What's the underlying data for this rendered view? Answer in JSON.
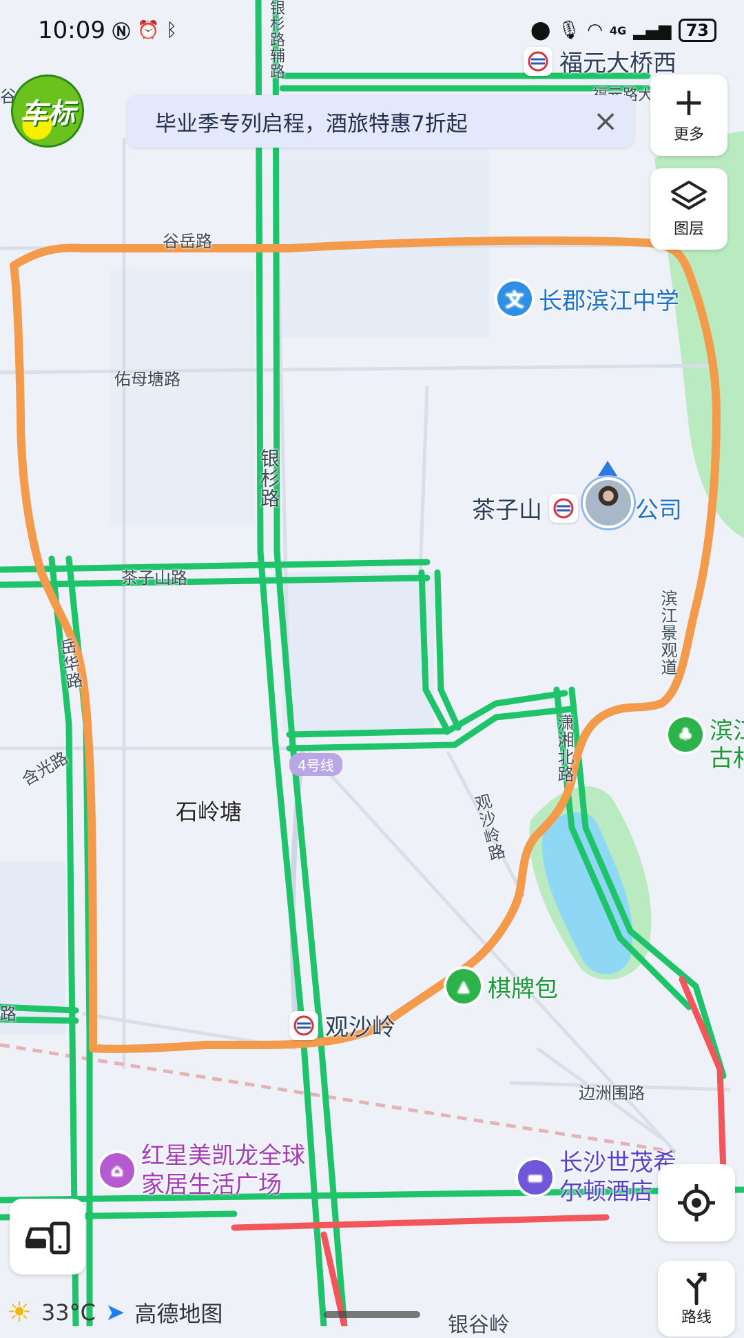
{
  "status_bar": {
    "time": "10:09",
    "battery": "73",
    "network": "4G"
  },
  "banner": {
    "text": "毕业季专列启程，酒旅特惠7折起"
  },
  "logo": {
    "text": "车标"
  },
  "controls": {
    "more_label": "更多",
    "layers_label": "图层",
    "route_label": "路线"
  },
  "road_labels": {
    "guyue": "谷岳路",
    "youmutang": "佑母塘路",
    "yinshan": "银杉路",
    "chazishan": "茶子山路",
    "yuehua": "岳华路",
    "hanguang": "含光路",
    "guanshaling_road": "观沙岭路",
    "xiaoxiang_north": "潇湘北路",
    "binjiang_jingguan": "滨江景观道",
    "bianzhouwei": "边洲围路",
    "fuyuan_road": "福元路大",
    "road_left": "路",
    "road_left2": "谷",
    "partial_top": "银杉路辅路",
    "partial_right": "滨江",
    "partial_right2": "古村",
    "partial_bottom": "银谷岭"
  },
  "metro_line": "4号线",
  "place_labels": {
    "shilingtang": "石岭塘"
  },
  "pois": {
    "fuyuan_bridge": "福元大桥西",
    "school": "长郡滨江中学",
    "school_icon": "文",
    "chazishan_station": "茶子山",
    "company": "公司",
    "guanshaling_station": "观沙岭",
    "qipaibao": "棋牌包",
    "mall_line1": "红星美凯龙全球",
    "mall_line2": "家居生活广场",
    "hotel_line1": "长沙世茂希",
    "hotel_line2": "尔顿酒店"
  },
  "weather": {
    "temp": "33°C"
  },
  "brand": "高德地图",
  "colors": {
    "road_green": "#1fc46a",
    "road_red": "#f2555a",
    "route_orange": "#f39a4b",
    "water": "#8fd8f5",
    "park": "#b9eac0",
    "map_bg": "#eef1f7"
  }
}
